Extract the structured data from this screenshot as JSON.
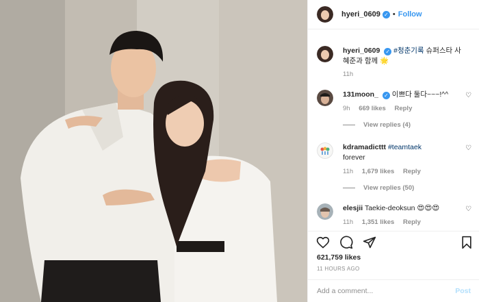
{
  "header": {
    "username": "hyeri_0609",
    "separator": "•",
    "follow_label": "Follow"
  },
  "caption": {
    "username": "hyeri_0609",
    "hashtag": "#청춘기록",
    "text": " 슈퍼스타 사혜준과 함께 🌟",
    "time": "11h"
  },
  "comments": [
    {
      "username": "131moon_",
      "verified": true,
      "text": "이쁘다 둘다~~~!^^",
      "time": "9h",
      "likes": "669 likes",
      "reply": "Reply",
      "view_replies": "View replies (4)"
    },
    {
      "username": "kdramadicttt",
      "verified": false,
      "hashtag": "#teamtaek",
      "text": "forever",
      "time": "11h",
      "likes": "1,679 likes",
      "reply": "Reply",
      "view_replies": "View replies (50)"
    },
    {
      "username": "elesjii",
      "verified": false,
      "text": "Taekie-deoksun 😍😍😍",
      "time": "11h",
      "likes": "1,351 likes",
      "reply": "Reply"
    }
  ],
  "icons": {
    "like": "heart-icon",
    "comment": "comment-icon",
    "share": "share-icon",
    "save": "bookmark-icon",
    "verified": "verified-badge-icon",
    "comment_like": "heart-outline-icon"
  },
  "stats": {
    "likes": "621,759 likes",
    "posted": "11 HOURS AGO"
  },
  "compose": {
    "placeholder": "Add a comment...",
    "post_label": "Post"
  },
  "colors": {
    "accent": "#3897f0",
    "post_disabled": "#b2dffc",
    "muted": "#8e8e8e"
  }
}
